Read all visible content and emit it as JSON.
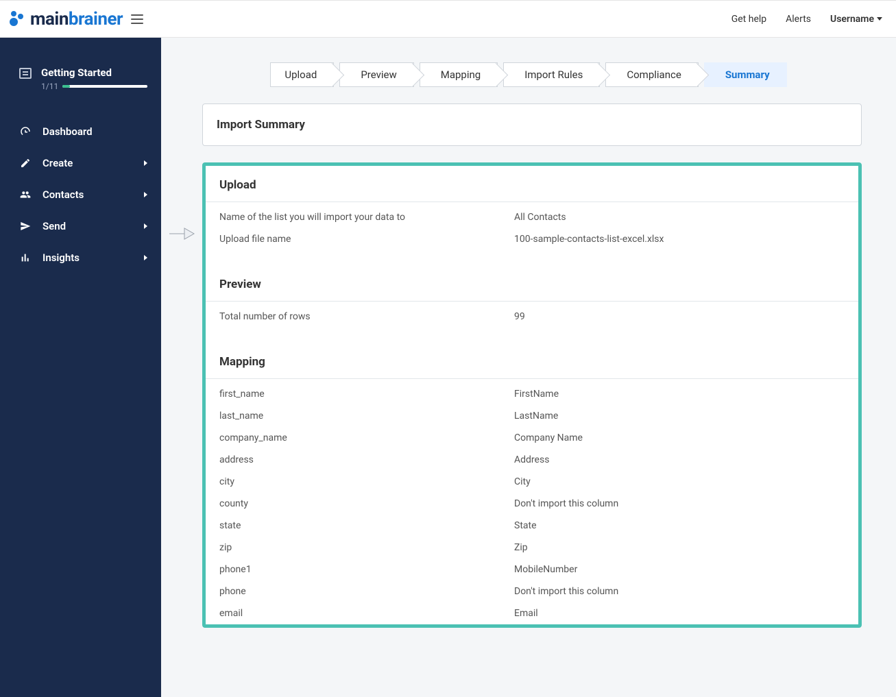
{
  "header": {
    "brand_main": "main",
    "brand_accent": "brainer",
    "get_help": "Get help",
    "alerts": "Alerts",
    "username": "Username"
  },
  "sidebar": {
    "getting_started": {
      "title": "Getting Started",
      "progress_label": "1/11"
    },
    "items": [
      {
        "label": "Dashboard",
        "icon": "gauge-icon",
        "expandable": false
      },
      {
        "label": "Create",
        "icon": "pencil-icon",
        "expandable": true
      },
      {
        "label": "Contacts",
        "icon": "users-icon",
        "expandable": true
      },
      {
        "label": "Send",
        "icon": "sendplane-icon",
        "expandable": true
      },
      {
        "label": "Insights",
        "icon": "chartbar-icon",
        "expandable": true
      }
    ]
  },
  "steps": {
    "items": [
      {
        "label": "Upload"
      },
      {
        "label": "Preview"
      },
      {
        "label": "Mapping"
      },
      {
        "label": "Import Rules"
      },
      {
        "label": "Compliance"
      },
      {
        "label": "Summary"
      }
    ],
    "active_index": 5
  },
  "panel_title": "Import Summary",
  "summary": {
    "upload": {
      "heading": "Upload",
      "rows": [
        {
          "key": "Name of the list you will import your data to",
          "val": "All Contacts"
        },
        {
          "key": "Upload file name",
          "val": "100-sample-contacts-list-excel.xlsx"
        }
      ]
    },
    "preview": {
      "heading": "Preview",
      "rows": [
        {
          "key": "Total number of rows",
          "val": "99"
        }
      ]
    },
    "mapping": {
      "heading": "Mapping",
      "rows": [
        {
          "key": "first_name",
          "val": "FirstName"
        },
        {
          "key": "last_name",
          "val": "LastName"
        },
        {
          "key": "company_name",
          "val": "Company Name"
        },
        {
          "key": "address",
          "val": "Address"
        },
        {
          "key": "city",
          "val": "City"
        },
        {
          "key": "county",
          "val": "Don't import this column"
        },
        {
          "key": "state",
          "val": "State"
        },
        {
          "key": "zip",
          "val": "Zip"
        },
        {
          "key": "phone1",
          "val": "MobileNumber"
        },
        {
          "key": "phone",
          "val": "Don't import this column"
        },
        {
          "key": "email",
          "val": "Email"
        }
      ]
    }
  }
}
